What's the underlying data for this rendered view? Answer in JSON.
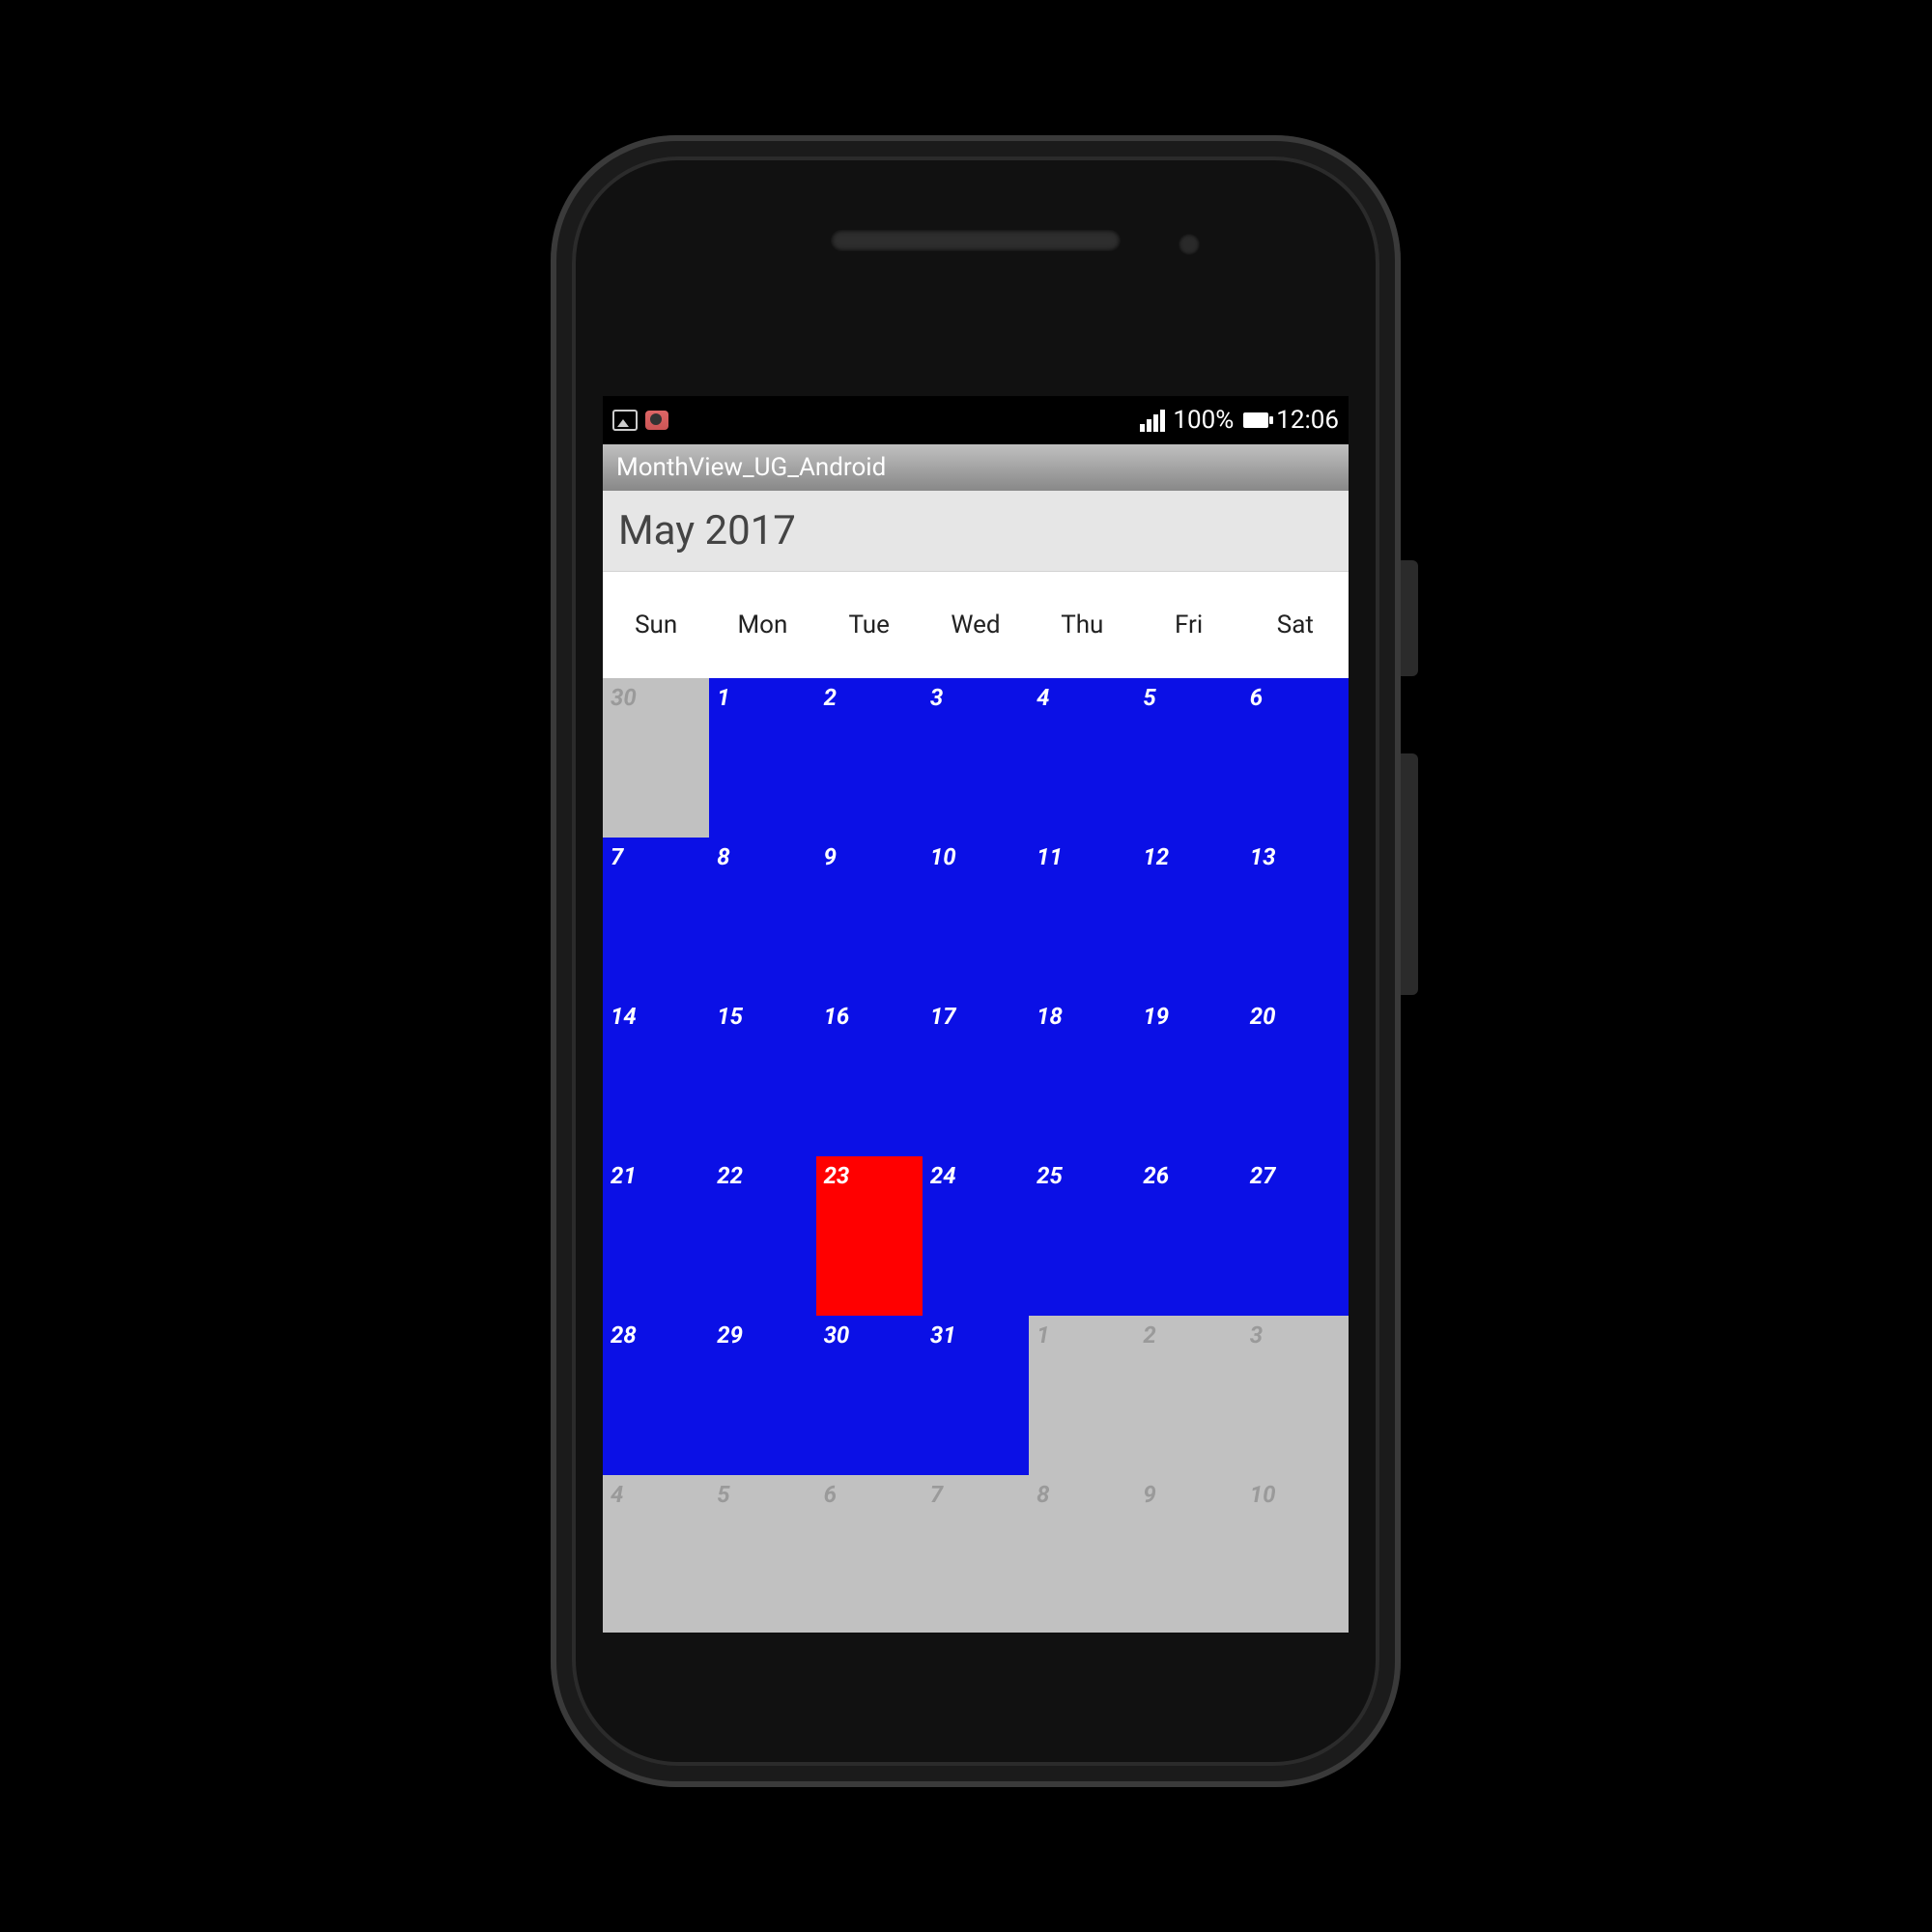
{
  "statusbar": {
    "battery_pct": "100%",
    "time": "12:06"
  },
  "appbar": {
    "title": "MonthView_UG_Android"
  },
  "calendar": {
    "month_label": "May 2017",
    "weekdays": [
      "Sun",
      "Mon",
      "Tue",
      "Wed",
      "Thu",
      "Fri",
      "Sat"
    ],
    "today": 23,
    "cells": [
      {
        "d": "30",
        "in": false
      },
      {
        "d": "1",
        "in": true
      },
      {
        "d": "2",
        "in": true
      },
      {
        "d": "3",
        "in": true
      },
      {
        "d": "4",
        "in": true
      },
      {
        "d": "5",
        "in": true
      },
      {
        "d": "6",
        "in": true
      },
      {
        "d": "7",
        "in": true
      },
      {
        "d": "8",
        "in": true
      },
      {
        "d": "9",
        "in": true
      },
      {
        "d": "10",
        "in": true
      },
      {
        "d": "11",
        "in": true
      },
      {
        "d": "12",
        "in": true
      },
      {
        "d": "13",
        "in": true
      },
      {
        "d": "14",
        "in": true
      },
      {
        "d": "15",
        "in": true
      },
      {
        "d": "16",
        "in": true
      },
      {
        "d": "17",
        "in": true
      },
      {
        "d": "18",
        "in": true
      },
      {
        "d": "19",
        "in": true
      },
      {
        "d": "20",
        "in": true
      },
      {
        "d": "21",
        "in": true
      },
      {
        "d": "22",
        "in": true
      },
      {
        "d": "23",
        "in": true,
        "today": true
      },
      {
        "d": "24",
        "in": true
      },
      {
        "d": "25",
        "in": true
      },
      {
        "d": "26",
        "in": true
      },
      {
        "d": "27",
        "in": true
      },
      {
        "d": "28",
        "in": true
      },
      {
        "d": "29",
        "in": true
      },
      {
        "d": "30",
        "in": true
      },
      {
        "d": "31",
        "in": true
      },
      {
        "d": "1",
        "in": false
      },
      {
        "d": "2",
        "in": false
      },
      {
        "d": "3",
        "in": false
      },
      {
        "d": "4",
        "in": false
      },
      {
        "d": "5",
        "in": false
      },
      {
        "d": "6",
        "in": false
      },
      {
        "d": "7",
        "in": false
      },
      {
        "d": "8",
        "in": false
      },
      {
        "d": "9",
        "in": false
      },
      {
        "d": "10",
        "in": false
      }
    ]
  },
  "colors": {
    "cell_in": "#0b10e6",
    "cell_out": "#c1c1c1",
    "cell_today": "#ff0000"
  }
}
